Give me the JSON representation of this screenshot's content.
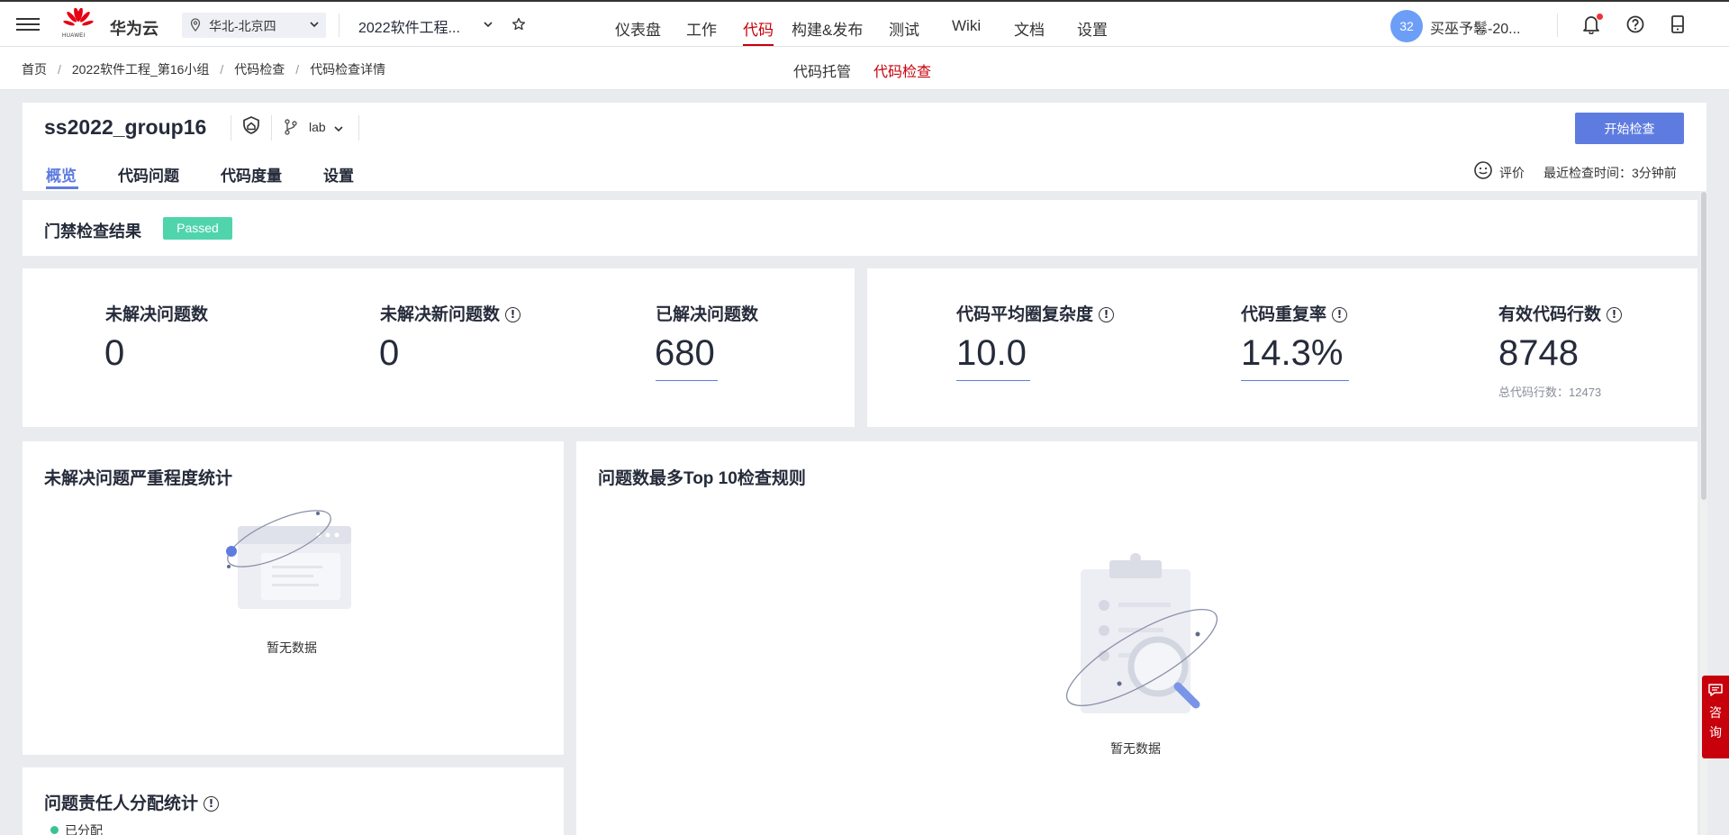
{
  "topnav": {
    "brand": "华为云",
    "logo_word": "HUAWEI",
    "region": "华北-北京四",
    "project": "2022软件工程...",
    "nav": [
      "仪表盘",
      "工作",
      "代码",
      "构建&发布",
      "测试",
      "Wiki",
      "文档",
      "设置"
    ],
    "active_nav": "代码",
    "avatar_text": "32",
    "username": "买巫予鬈-20..."
  },
  "breadcrumb": [
    "首页",
    "2022软件工程_第16小组",
    "代码检查",
    "代码检查详情"
  ],
  "subtabs": {
    "hosting": "代码托管",
    "check": "代码检查"
  },
  "repo": {
    "name": "ss2022_group16",
    "branch": "lab",
    "start_button": "开始检查",
    "tabs": [
      "概览",
      "代码问题",
      "代码度量",
      "设置"
    ],
    "rate_label": "评价",
    "last_check": "最近检查时间：3分钟前"
  },
  "gate": {
    "title": "门禁检查结果",
    "status": "Passed"
  },
  "metrics": {
    "unresolved": {
      "label": "未解决问题数",
      "value": "0"
    },
    "unresolved_new": {
      "label": "未解决新问题数",
      "value": "0"
    },
    "resolved": {
      "label": "已解决问题数",
      "value": "680"
    },
    "complexity": {
      "label": "代码平均圈复杂度",
      "value": "10.0"
    },
    "duplication": {
      "label": "代码重复率",
      "value": "14.3%"
    },
    "effective_lines": {
      "label": "有效代码行数",
      "value": "8748",
      "sub": "总代码行数：12473"
    }
  },
  "panels": {
    "severity": {
      "title": "未解决问题严重程度统计",
      "empty": "暂无数据"
    },
    "top_rules": {
      "title": "问题数最多Top 10检查规则",
      "empty": "暂无数据"
    },
    "assignee": {
      "title": "问题责任人分配统计",
      "legend": "已分配"
    }
  },
  "consult": {
    "label_1": "咨",
    "label_2": "询"
  },
  "colors": {
    "brand_red": "#c7000b",
    "accent_blue": "#5e7ce0",
    "passed_green": "#50d4ab"
  }
}
